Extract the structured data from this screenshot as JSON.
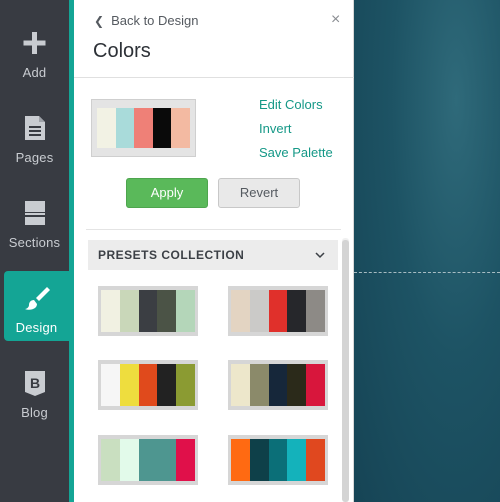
{
  "rail": {
    "items": [
      {
        "label": "Add",
        "icon": "plus-icon"
      },
      {
        "label": "Pages",
        "icon": "document-icon"
      },
      {
        "label": "Sections",
        "icon": "sections-icon"
      },
      {
        "label": "Design",
        "icon": "paintbrush-icon",
        "active": true
      },
      {
        "label": "Blog",
        "icon": "blog-icon"
      }
    ]
  },
  "panel": {
    "back_label": "Back to Design",
    "close_glyph": "×",
    "title": "Colors",
    "links": {
      "edit_colors": "Edit Colors",
      "invert": "Invert",
      "save_palette": "Save Palette"
    },
    "buttons": {
      "apply": "Apply",
      "revert": "Revert"
    },
    "current_palette": [
      "#f2f2e4",
      "#a9dbda",
      "#ef8077",
      "#0a0a0a",
      "#f3baa2"
    ],
    "presets_header": "PRESETS COLLECTION",
    "presets": [
      [
        "#f1f1e2",
        "#c9d7b9",
        "#3b3e43",
        "#4b5346",
        "#b4d6b9"
      ],
      [
        "#e3d4c2",
        "#cbcac8",
        "#e0302b",
        "#26272b",
        "#8d8a86"
      ],
      [
        "#f6f6f6",
        "#eedd3e",
        "#e04a1c",
        "#222222",
        "#8b9b32"
      ],
      [
        "#ede7cb",
        "#8b8a6a",
        "#16273a",
        "#2b2a1a",
        "#d8163c"
      ],
      [
        "#c9dfc0",
        "#e2faea",
        "#4e9690",
        "#4e9690",
        "#e0104a"
      ],
      [
        "#ff6a12",
        "#0e4049",
        "#0b6f78",
        "#14b2bb",
        "#e0481f"
      ]
    ]
  },
  "colors": {
    "accent": "#14a595",
    "apply_green": "#5ab95a",
    "canvas": "#1d5364"
  }
}
